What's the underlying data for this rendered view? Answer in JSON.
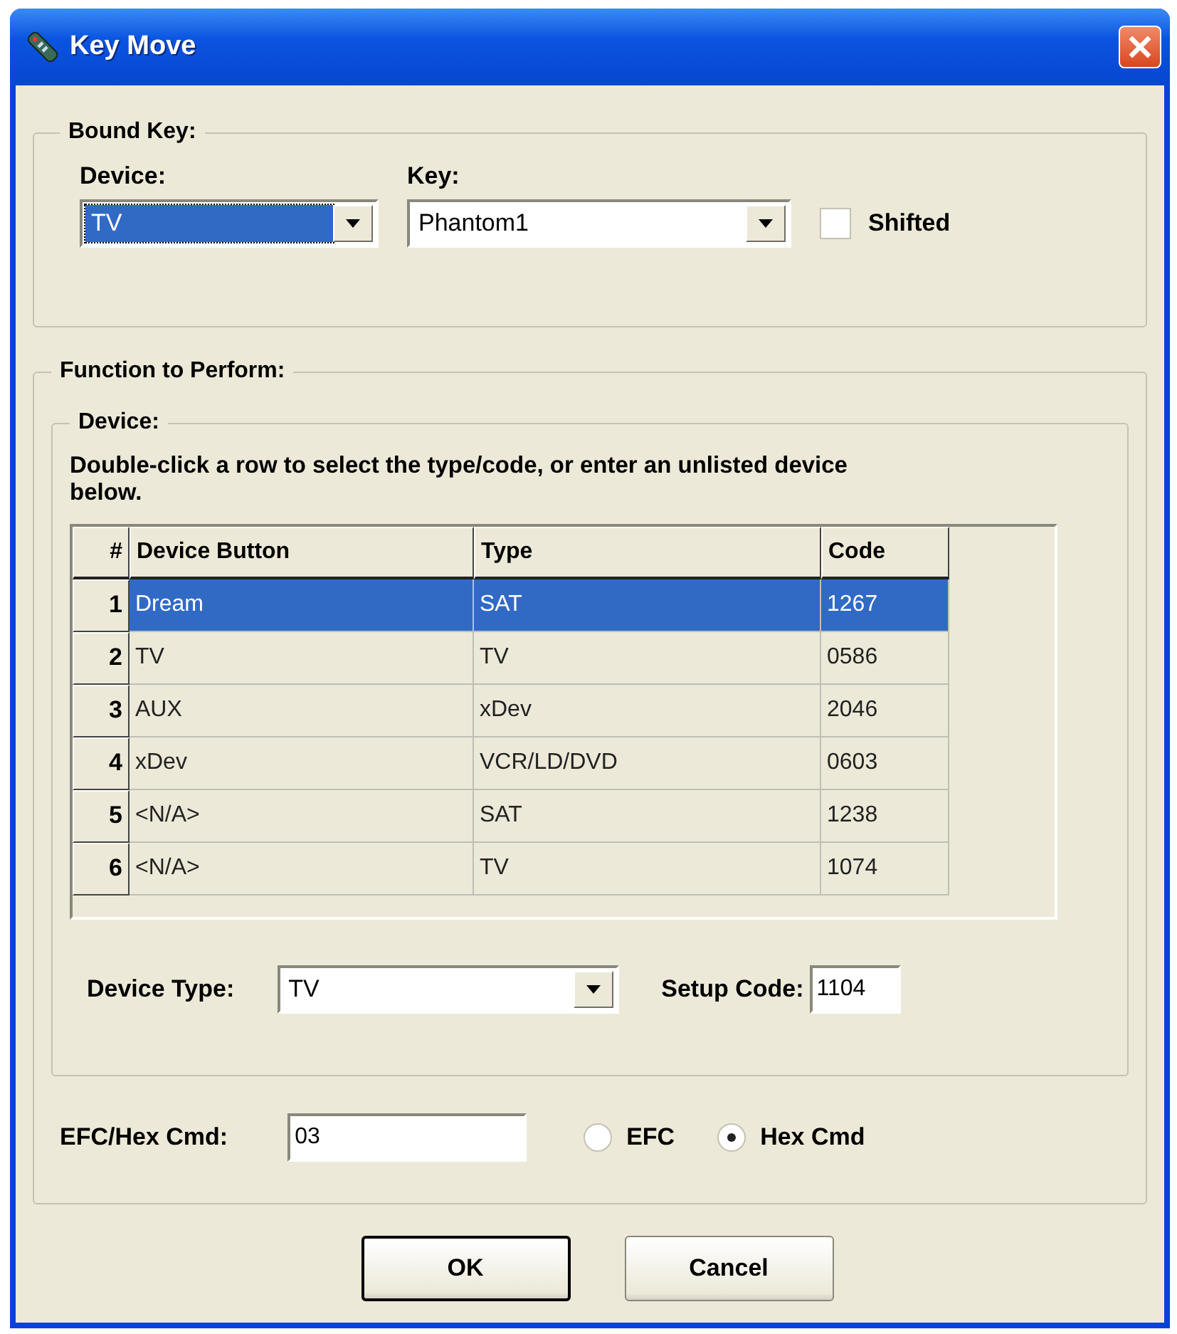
{
  "window": {
    "title": "Key Move"
  },
  "bound_key": {
    "title": "Bound Key:",
    "device": {
      "label": "Device:",
      "value": "TV",
      "highlighted": true
    },
    "key": {
      "label": "Key:",
      "value": "Phantom1",
      "highlighted": false
    },
    "shifted": {
      "label": "Shifted",
      "checked": false
    }
  },
  "function": {
    "title": "Function to Perform:",
    "device_group": {
      "title": "Device:",
      "instructions": "Double-click a row to select the type/code, or enter an unlisted device below.",
      "table": {
        "columns": [
          "#",
          "Device Button",
          "Type",
          "Code"
        ],
        "rows": [
          {
            "cells": [
              "1",
              "Dream",
              "SAT",
              "1267"
            ],
            "selected": true
          },
          {
            "cells": [
              "2",
              "TV",
              "TV",
              "0586"
            ],
            "selected": false
          },
          {
            "cells": [
              "3",
              "AUX",
              "xDev",
              "2046"
            ],
            "selected": false
          },
          {
            "cells": [
              "4",
              "xDev",
              "VCR/LD/DVD",
              "0603"
            ],
            "selected": false
          },
          {
            "cells": [
              "5",
              "<N/A>",
              "SAT",
              "1238"
            ],
            "selected": false
          },
          {
            "cells": [
              "6",
              "<N/A>",
              "TV",
              "1074"
            ],
            "selected": false
          }
        ]
      },
      "device_type": {
        "label": "Device Type:",
        "value": "TV"
      },
      "setup_code": {
        "label": "Setup Code:",
        "value": "1104"
      }
    },
    "efc_hex": {
      "label": "EFC/Hex Cmd:",
      "value": "03"
    },
    "modes": [
      {
        "label": "EFC",
        "selected": false
      },
      {
        "label": "Hex Cmd",
        "selected": true
      }
    ]
  },
  "buttons": [
    {
      "label": "OK",
      "default": true
    },
    {
      "label": "Cancel",
      "default": false
    }
  ]
}
